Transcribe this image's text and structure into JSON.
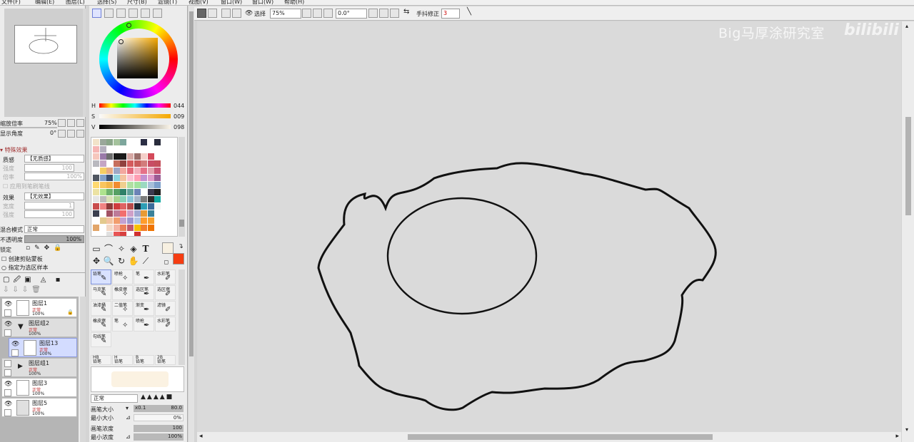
{
  "menu": [
    "文件(F)",
    "编辑(E)",
    "图层(L)",
    "选择(S)",
    "尺寸(B)",
    "滤镜(T)",
    "视图(V)",
    "窗口(W)",
    "帮助(H)"
  ],
  "toolbar": {
    "select_label": "选择",
    "zoom": "75%",
    "angle": "0.0°",
    "stabilizer_label": "手抖修正",
    "stabilizer": "3"
  },
  "watermark": {
    "text": "Big马厚涂研究室",
    "logo": "bilibili"
  },
  "navigator": {
    "zoom_label": "缩放倍率",
    "zoom_value": "75%",
    "angle_label": "显示角度",
    "angle_value": "0°"
  },
  "effects": {
    "header": "特殊效果",
    "texture_label": "质感",
    "texture_value": "【无质感】",
    "scale_label": "强度",
    "scale_value": "100",
    "scale2_label": "倍率",
    "scale2_value": "100%",
    "apply_label": "应用到笔刷笔线",
    "effect_label": "效果",
    "effect_value": "【无效果】",
    "width_label": "宽度",
    "width_value": "1",
    "strength_label": "强度",
    "strength_value": "100"
  },
  "layer_props": {
    "blend_label": "混合模式",
    "blend_value": "正常",
    "opacity_label": "不透明度",
    "opacity_value": "100%",
    "lock_label": "锁定",
    "clip_label": "创建剪贴蒙板",
    "select_source_label": "指定为选区样本"
  },
  "layers": [
    {
      "name": "图层1",
      "mode": "正常",
      "opacity": "100%"
    },
    {
      "name": "图层组2",
      "mode": "正常",
      "opacity": "100%"
    },
    {
      "name": "图层13",
      "mode": "正常",
      "opacity": "100%"
    },
    {
      "name": "图层组1",
      "mode": "正常",
      "opacity": "100%"
    },
    {
      "name": "图层3",
      "mode": "正常",
      "opacity": "100%"
    },
    {
      "name": "图层5",
      "mode": "正常",
      "opacity": "100%"
    }
  ],
  "color": {
    "h_label": "H",
    "h": "044",
    "s_label": "S",
    "s": "009",
    "v_label": "V",
    "v": "098",
    "main_color": "#f7f0e1",
    "sub_color": "#f53d12"
  },
  "brushes": [
    {
      "name": "铅笔",
      "sel": true
    },
    {
      "name": "喷枪"
    },
    {
      "name": "笔"
    },
    {
      "name": "水彩笔"
    },
    {
      "name": "马克笔"
    },
    {
      "name": "橡皮擦"
    },
    {
      "name": "选区笔"
    },
    {
      "name": "选区擦"
    },
    {
      "name": "油漆桶"
    },
    {
      "name": "二值笔"
    },
    {
      "name": "渐变"
    },
    {
      "name": "滤镜"
    },
    {
      "name": "橡皮擦"
    },
    {
      "name": "笔"
    },
    {
      "name": "喷枪"
    },
    {
      "name": "水彩笔"
    },
    {
      "name": "勾线笔"
    }
  ],
  "brush_sizes": [
    {
      "top": "HB",
      "bot": "铅笔"
    },
    {
      "top": "H",
      "bot": "铅笔"
    },
    {
      "top": "B",
      "bot": "铅笔"
    },
    {
      "top": "2B",
      "bot": "铅笔"
    }
  ],
  "brush_settings": {
    "blend": "正常",
    "size_label": "画笔大小",
    "size_mult": "x0.1",
    "size_value": "80.0",
    "min_size_label": "最小大小",
    "min_size_value": "0%",
    "density_label": "画笔浓度",
    "density_value": "100",
    "min_density_label": "最小浓度",
    "min_density_value": "100%"
  }
}
